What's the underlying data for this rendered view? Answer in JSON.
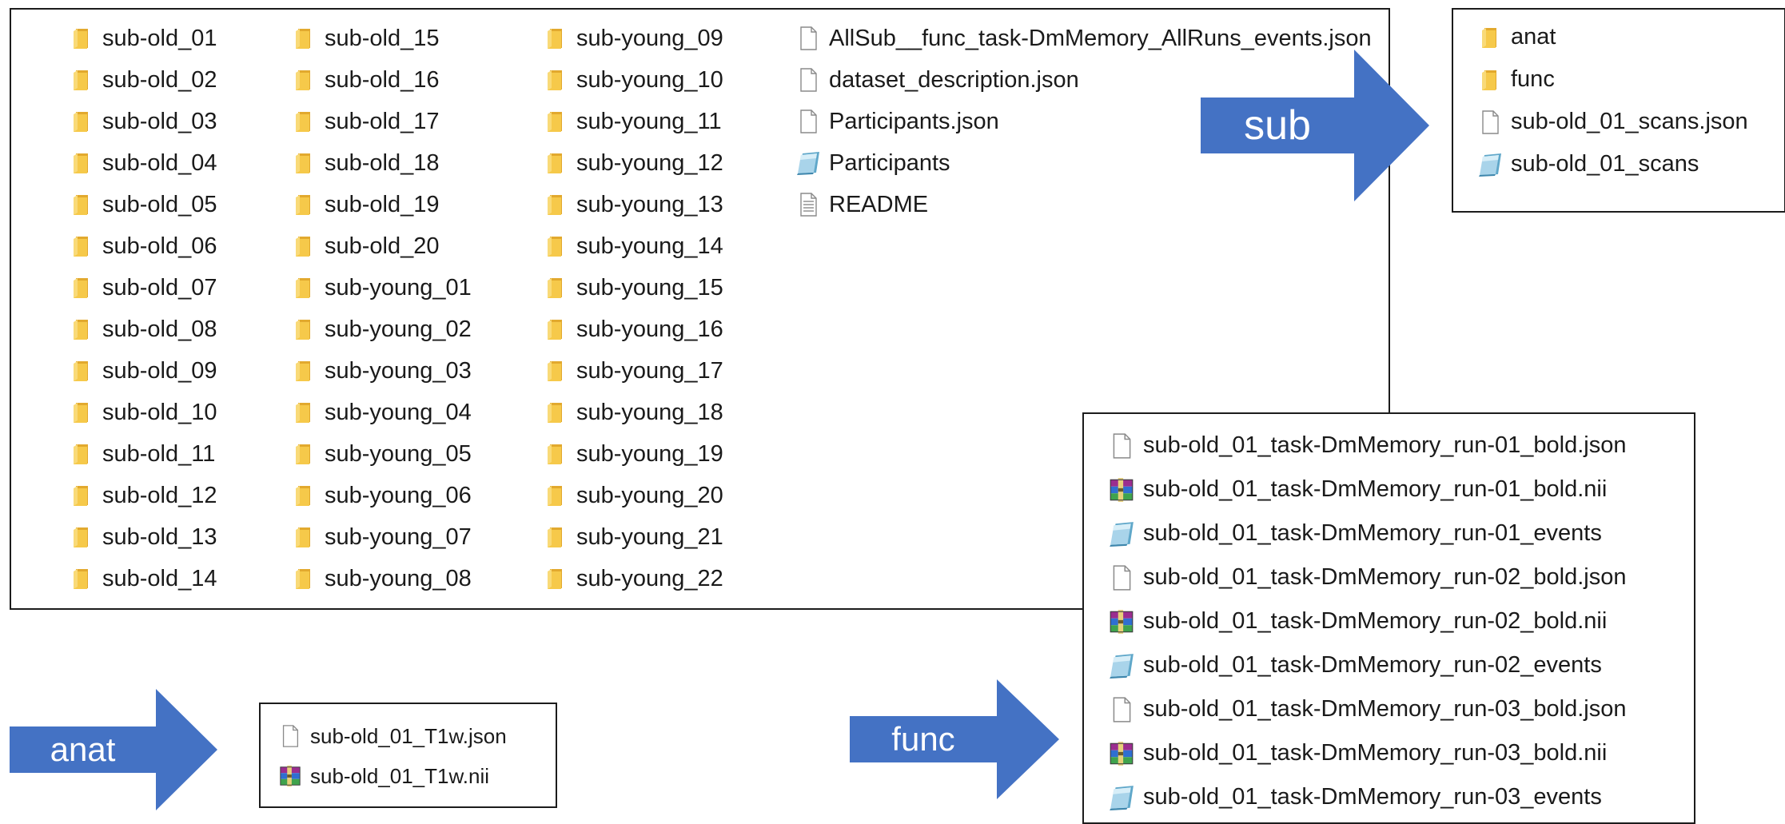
{
  "root_listing": {
    "col1": [
      {
        "name": "sub-old_01",
        "type": "folder"
      },
      {
        "name": "sub-old_02",
        "type": "folder"
      },
      {
        "name": "sub-old_03",
        "type": "folder"
      },
      {
        "name": "sub-old_04",
        "type": "folder"
      },
      {
        "name": "sub-old_05",
        "type": "folder"
      },
      {
        "name": "sub-old_06",
        "type": "folder"
      },
      {
        "name": "sub-old_07",
        "type": "folder"
      },
      {
        "name": "sub-old_08",
        "type": "folder"
      },
      {
        "name": "sub-old_09",
        "type": "folder"
      },
      {
        "name": "sub-old_10",
        "type": "folder"
      },
      {
        "name": "sub-old_11",
        "type": "folder"
      },
      {
        "name": "sub-old_12",
        "type": "folder"
      },
      {
        "name": "sub-old_13",
        "type": "folder"
      },
      {
        "name": "sub-old_14",
        "type": "folder"
      }
    ],
    "col2": [
      {
        "name": "sub-old_15",
        "type": "folder"
      },
      {
        "name": "sub-old_16",
        "type": "folder"
      },
      {
        "name": "sub-old_17",
        "type": "folder"
      },
      {
        "name": "sub-old_18",
        "type": "folder"
      },
      {
        "name": "sub-old_19",
        "type": "folder"
      },
      {
        "name": "sub-old_20",
        "type": "folder"
      },
      {
        "name": "sub-young_01",
        "type": "folder"
      },
      {
        "name": "sub-young_02",
        "type": "folder"
      },
      {
        "name": "sub-young_03",
        "type": "folder"
      },
      {
        "name": "sub-young_04",
        "type": "folder"
      },
      {
        "name": "sub-young_05",
        "type": "folder"
      },
      {
        "name": "sub-young_06",
        "type": "folder"
      },
      {
        "name": "sub-young_07",
        "type": "folder"
      },
      {
        "name": "sub-young_08",
        "type": "folder"
      }
    ],
    "col3": [
      {
        "name": "sub-young_09",
        "type": "folder"
      },
      {
        "name": "sub-young_10",
        "type": "folder"
      },
      {
        "name": "sub-young_11",
        "type": "folder"
      },
      {
        "name": "sub-young_12",
        "type": "folder"
      },
      {
        "name": "sub-young_13",
        "type": "folder"
      },
      {
        "name": "sub-young_14",
        "type": "folder"
      },
      {
        "name": "sub-young_15",
        "type": "folder"
      },
      {
        "name": "sub-young_16",
        "type": "folder"
      },
      {
        "name": "sub-young_17",
        "type": "folder"
      },
      {
        "name": "sub-young_18",
        "type": "folder"
      },
      {
        "name": "sub-young_19",
        "type": "folder"
      },
      {
        "name": "sub-young_20",
        "type": "folder"
      },
      {
        "name": "sub-young_21",
        "type": "folder"
      },
      {
        "name": "sub-young_22",
        "type": "folder"
      }
    ],
    "col4": [
      {
        "name": "AllSub__func_task-DmMemory_AllRuns_events.json",
        "type": "file"
      },
      {
        "name": "dataset_description.json",
        "type": "file"
      },
      {
        "name": "Participants.json",
        "type": "file"
      },
      {
        "name": "Participants",
        "type": "sheet"
      },
      {
        "name": "README",
        "type": "text"
      }
    ]
  },
  "sub_listing": {
    "items": [
      {
        "name": "anat",
        "type": "folder"
      },
      {
        "name": "func",
        "type": "folder"
      },
      {
        "name": "sub-old_01_scans.json",
        "type": "file"
      },
      {
        "name": "sub-old_01_scans",
        "type": "sheet"
      }
    ]
  },
  "anat_listing": {
    "items": [
      {
        "name": "sub-old_01_T1w.json",
        "type": "file"
      },
      {
        "name": "sub-old_01_T1w.nii",
        "type": "archive"
      }
    ]
  },
  "func_listing": {
    "items": [
      {
        "name": "sub-old_01_task-DmMemory_run-01_bold.json",
        "type": "file"
      },
      {
        "name": "sub-old_01_task-DmMemory_run-01_bold.nii",
        "type": "archive"
      },
      {
        "name": "sub-old_01_task-DmMemory_run-01_events",
        "type": "sheet"
      },
      {
        "name": "sub-old_01_task-DmMemory_run-02_bold.json",
        "type": "file"
      },
      {
        "name": "sub-old_01_task-DmMemory_run-02_bold.nii",
        "type": "archive"
      },
      {
        "name": "sub-old_01_task-DmMemory_run-02_events",
        "type": "sheet"
      },
      {
        "name": "sub-old_01_task-DmMemory_run-03_bold.json",
        "type": "file"
      },
      {
        "name": "sub-old_01_task-DmMemory_run-03_bold.nii",
        "type": "archive"
      },
      {
        "name": "sub-old_01_task-DmMemory_run-03_events",
        "type": "sheet"
      }
    ]
  },
  "arrows": {
    "sub": "sub",
    "anat": "anat",
    "func": "func"
  },
  "colors": {
    "arrow_fill": "#4472C4",
    "folder": "#F6C94A",
    "folder_dark": "#E2A92E",
    "border": "#1C1C1C"
  }
}
